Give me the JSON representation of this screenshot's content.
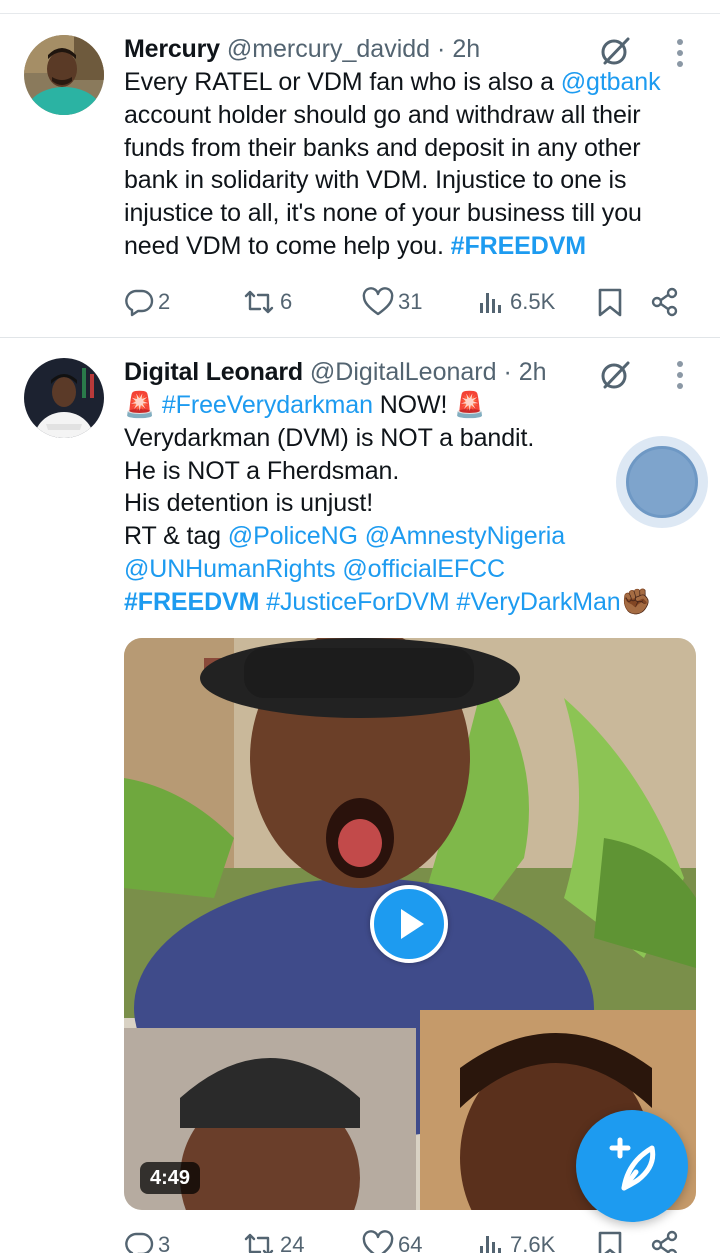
{
  "colors": {
    "accent": "#1d9bf0",
    "text": "#0f1419",
    "secondary": "#536471"
  },
  "tweets": [
    {
      "name": "Mercury",
      "handle": "@mercury_davidd",
      "dot": "·",
      "time": "2h",
      "lines": [
        [
          {
            "t": "Every RATEL or VDM fan who is also a "
          },
          {
            "t": "@gtbank",
            "k": "link"
          }
        ],
        [
          {
            "t": "account holder should go and withdraw all their"
          }
        ],
        [
          {
            "t": "funds from their banks and deposit in any other"
          }
        ],
        [
          {
            "t": "bank in solidarity with VDM. Injustice to one is"
          }
        ],
        [
          {
            "t": "injustice to all, it's none of your business till you"
          }
        ],
        [
          {
            "t": "need VDM to come help you. "
          },
          {
            "t": "#FREEDVM",
            "k": "tag"
          }
        ]
      ],
      "stats": {
        "replies": "2",
        "reposts": "6",
        "likes": "31",
        "views": "6.5K"
      }
    },
    {
      "name": "Digital Leonard",
      "handle": "@DigitalLeonard",
      "dot": "·",
      "time": "2h",
      "lines": [
        [
          {
            "t": "🚨 "
          },
          {
            "t": "#FreeVerydarkman",
            "k": "link"
          },
          {
            "t": " NOW! 🚨"
          }
        ],
        [
          {
            "t": "Verydarkman (DVM) is NOT a bandit."
          }
        ],
        [
          {
            "t": "He is NOT a Fherdsman."
          }
        ],
        [
          {
            "t": "His detention is unjust!"
          }
        ],
        [
          {
            "t": "RT & tag "
          },
          {
            "t": "@PoliceNG",
            "k": "link"
          },
          {
            "t": " "
          },
          {
            "t": "@AmnestyNigeria",
            "k": "link"
          }
        ],
        [
          {
            "t": "@UNHumanRights",
            "k": "link"
          },
          {
            "t": " "
          },
          {
            "t": "@officialEFCC",
            "k": "link"
          }
        ],
        [
          {
            "t": "#FREEDVM",
            "k": "tag"
          },
          {
            "t": " "
          },
          {
            "t": "#JusticeForDVM",
            "k": "link"
          },
          {
            "t": " "
          },
          {
            "t": "#VeryDarkMan",
            "k": "link"
          },
          {
            "t": "✊🏾"
          }
        ]
      ],
      "media": {
        "duration": "4:49"
      },
      "stats": {
        "replies": "3",
        "reposts": "24",
        "likes": "64",
        "views": "7.6K"
      }
    }
  ],
  "icons": {
    "reply": "reply-icon",
    "repost": "repost-icon",
    "like": "heart-icon",
    "views": "views-icon",
    "bookmark": "bookmark-icon",
    "share": "share-icon",
    "grok": "grok-icon",
    "more": "more-icon",
    "compose": "compose-icon",
    "play": "play-icon"
  }
}
